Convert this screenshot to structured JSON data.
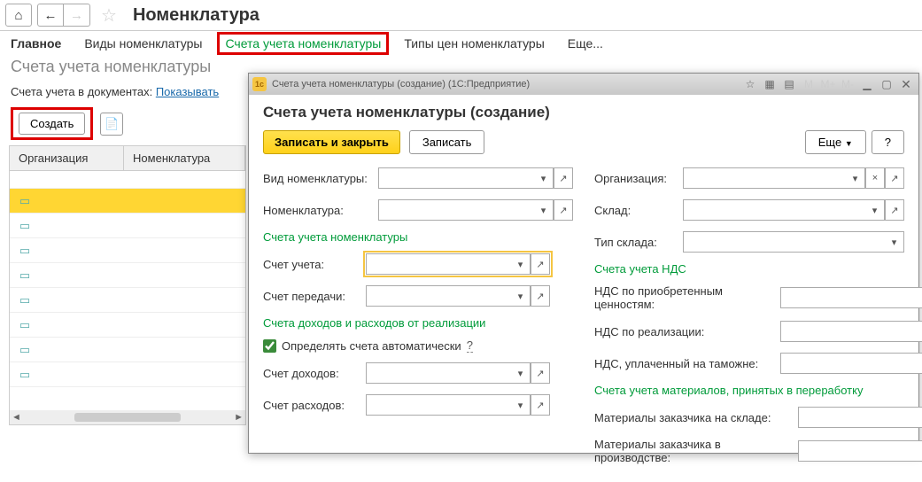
{
  "header": {
    "title": "Номенклатура"
  },
  "tabs": {
    "main": "Главное",
    "kinds": "Виды номенклатуры",
    "accounts": "Счета учета номенклатуры",
    "price_types": "Типы цен номенклатуры",
    "more": "Еще..."
  },
  "sub_header": "Счета учета номенклатуры",
  "filter": {
    "label": "Счета учета в документах: ",
    "link": "Показывать"
  },
  "toolbar": {
    "create": "Создать"
  },
  "grid": {
    "col1": "Организация",
    "col2": "Номенклатура"
  },
  "dialog": {
    "titlebar": "Счета учета номенклатуры (создание)  (1С:Предприятие)",
    "title": "Счета учета номенклатуры (создание)",
    "save_close": "Записать и закрыть",
    "save": "Записать",
    "more": "Еще",
    "help": "?",
    "left": {
      "kind": "Вид номенклатуры:",
      "nomen": "Номенклатура:",
      "sec1": "Счета учета номенклатуры",
      "acct": "Счет учета:",
      "transfer": "Счет передачи:",
      "sec2": "Счета доходов и расходов от реализации",
      "auto": "Определять счета автоматически",
      "auto_q": "?",
      "income": "Счет доходов:",
      "expense": "Счет расходов:"
    },
    "right": {
      "org": "Организация:",
      "warehouse": "Склад:",
      "wh_type": "Тип склада:",
      "sec1": "Счета учета НДС",
      "vat_purchase": "НДС по приобретенным ценностям:",
      "vat_sale": "НДС по реализации:",
      "vat_customs": "НДС, уплаченный на таможне:",
      "sec2": "Счета учета материалов, принятых в переработку",
      "mat_stock": "Материалы заказчика на складе:",
      "mat_prod": "Материалы заказчика в производстве:"
    }
  }
}
